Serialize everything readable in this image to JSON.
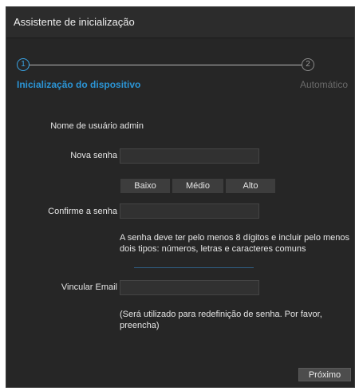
{
  "window": {
    "title": "Assistente de inicialização"
  },
  "steps": [
    {
      "number": "1",
      "label": "Inicialização do dispositivo",
      "state": "active"
    },
    {
      "number": "2",
      "label": "Automático",
      "state": "inactive"
    }
  ],
  "form": {
    "username_label": "Nome de usuário",
    "username_value": "admin",
    "new_password_label": "Nova senha",
    "new_password_value": "",
    "strength_levels": [
      "Baixo",
      "Médio",
      "Alto"
    ],
    "confirm_password_label": "Confirme a senha",
    "confirm_password_value": "",
    "password_hint": "A senha deve ter pelo menos 8 dígitos e incluir pelo menos dois tipos: números, letras e caracteres comuns",
    "email_label": "Vincular Email",
    "email_value": "",
    "email_hint": "(Será utilizado para redefinição de senha. Por favor, preencha)"
  },
  "footer": {
    "next_label": "Próximo"
  },
  "colors": {
    "accent": "#2b95d6",
    "background": "#262626",
    "titlebar": "#2c2c2c",
    "input_bg": "#313131"
  }
}
